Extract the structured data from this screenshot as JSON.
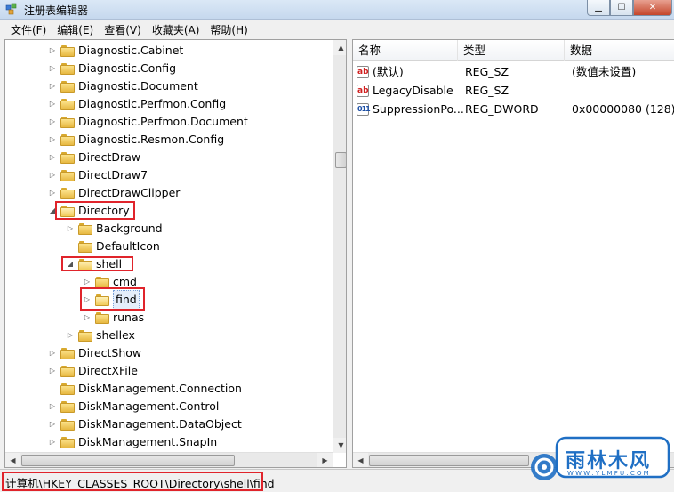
{
  "window": {
    "title": "注册表编辑器"
  },
  "menu": [
    "文件(F)",
    "编辑(E)",
    "查看(V)",
    "收藏夹(A)",
    "帮助(H)"
  ],
  "tree": [
    {
      "label": "Diagnostic.Cabinet",
      "level": 0,
      "expander": "collapsed"
    },
    {
      "label": "Diagnostic.Config",
      "level": 0,
      "expander": "collapsed"
    },
    {
      "label": "Diagnostic.Document",
      "level": 0,
      "expander": "collapsed"
    },
    {
      "label": "Diagnostic.Perfmon.Config",
      "level": 0,
      "expander": "collapsed"
    },
    {
      "label": "Diagnostic.Perfmon.Document",
      "level": 0,
      "expander": "collapsed"
    },
    {
      "label": "Diagnostic.Resmon.Config",
      "level": 0,
      "expander": "collapsed"
    },
    {
      "label": "DirectDraw",
      "level": 0,
      "expander": "collapsed"
    },
    {
      "label": "DirectDraw7",
      "level": 0,
      "expander": "collapsed"
    },
    {
      "label": "DirectDrawClipper",
      "level": 0,
      "expander": "collapsed"
    },
    {
      "label": "Directory",
      "level": 0,
      "expander": "expanded"
    },
    {
      "label": "Background",
      "level": 1,
      "expander": "collapsed"
    },
    {
      "label": "DefaultIcon",
      "level": 1,
      "expander": "none"
    },
    {
      "label": "shell",
      "level": 1,
      "expander": "expanded"
    },
    {
      "label": "cmd",
      "level": 2,
      "expander": "collapsed"
    },
    {
      "label": "find",
      "level": 2,
      "expander": "collapsed",
      "selected": true
    },
    {
      "label": "runas",
      "level": 2,
      "expander": "collapsed"
    },
    {
      "label": "shellex",
      "level": 1,
      "expander": "collapsed"
    },
    {
      "label": "DirectShow",
      "level": 0,
      "expander": "collapsed"
    },
    {
      "label": "DirectXFile",
      "level": 0,
      "expander": "collapsed"
    },
    {
      "label": "DiskManagement.Connection",
      "level": 0,
      "expander": "none"
    },
    {
      "label": "DiskManagement.Control",
      "level": 0,
      "expander": "collapsed"
    },
    {
      "label": "DiskManagement.DataObject",
      "level": 0,
      "expander": "collapsed"
    },
    {
      "label": "DiskManagement.SnapIn",
      "level": 0,
      "expander": "collapsed"
    }
  ],
  "list": {
    "columns": [
      "名称",
      "类型",
      "数据"
    ],
    "rows": [
      {
        "icon": "ab",
        "name": "(默认)",
        "type": "REG_SZ",
        "data": "(数值未设置)"
      },
      {
        "icon": "ab",
        "name": "LegacyDisable",
        "type": "REG_SZ",
        "data": ""
      },
      {
        "icon": "011",
        "name": "SuppressionPo...",
        "type": "REG_DWORD",
        "data": "0x00000080 (128)"
      }
    ]
  },
  "status": {
    "path": "计算机\\HKEY_CLASSES_ROOT\\Directory\\shell\\find"
  },
  "watermark": {
    "text": "雨林木风",
    "url": "W W W . Y L M F U . C O M"
  },
  "colors": {
    "highlight": "#e0242b",
    "titlebar": "#c6d8ee"
  }
}
